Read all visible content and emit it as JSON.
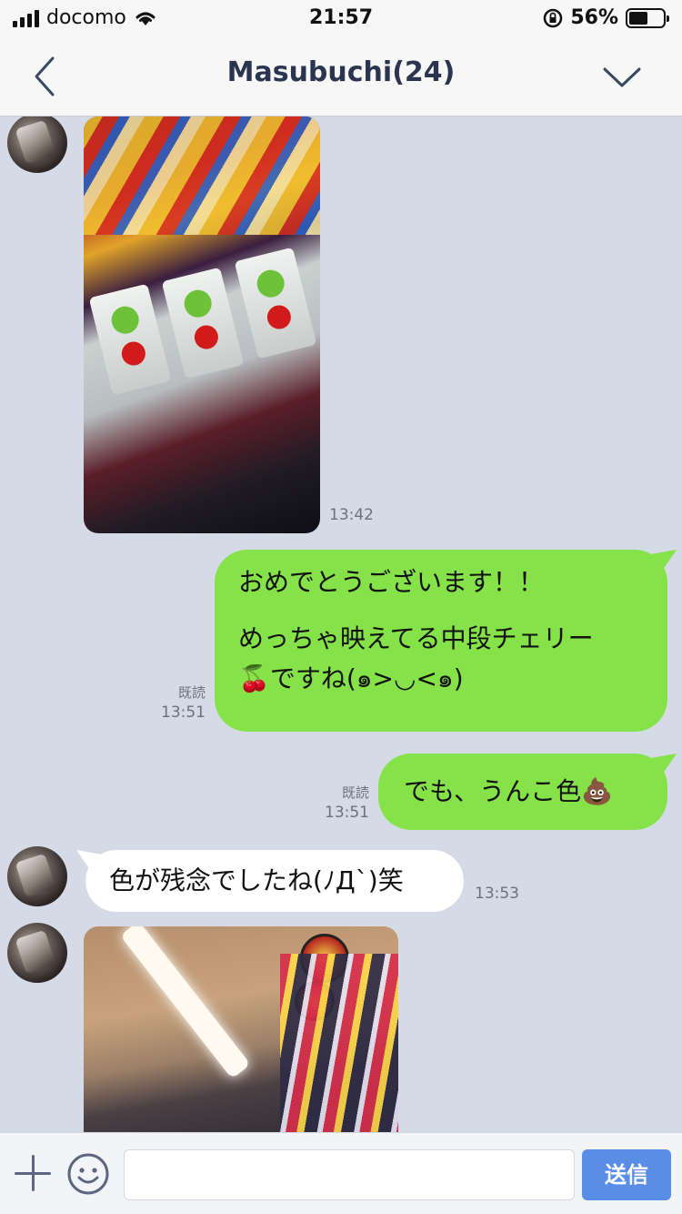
{
  "status_bar": {
    "carrier": "docomo",
    "time": "21:57",
    "battery_percent": "56%",
    "battery_level": 0.56
  },
  "header": {
    "title": "Masubuchi(24)",
    "back_icon": "chevron-left-icon",
    "menu_icon": "chevron-down-icon"
  },
  "messages": [
    {
      "type": "image",
      "side": "left",
      "time": "13:42"
    },
    {
      "type": "text",
      "side": "right",
      "read": "既読",
      "time": "13:51",
      "paragraphs": [
        "おめでとうございます！！",
        "めっちゃ映えてる中段チェリー\n🍒ですね(๑>◡<๑)"
      ]
    },
    {
      "type": "text",
      "side": "right",
      "read": "既読",
      "time": "13:51",
      "text": "でも、うんこ色💩"
    },
    {
      "type": "text",
      "side": "left",
      "time": "13:53",
      "text": "色が残念でしたね(ﾉД`)笑"
    },
    {
      "type": "image",
      "side": "left"
    }
  ],
  "input_bar": {
    "send_label": "送信",
    "placeholder": ""
  },
  "colors": {
    "chat_background": "#d5dbe6",
    "outgoing_bubble": "#85e249",
    "incoming_bubble": "#ffffff",
    "send_button": "#5a8ee6"
  }
}
